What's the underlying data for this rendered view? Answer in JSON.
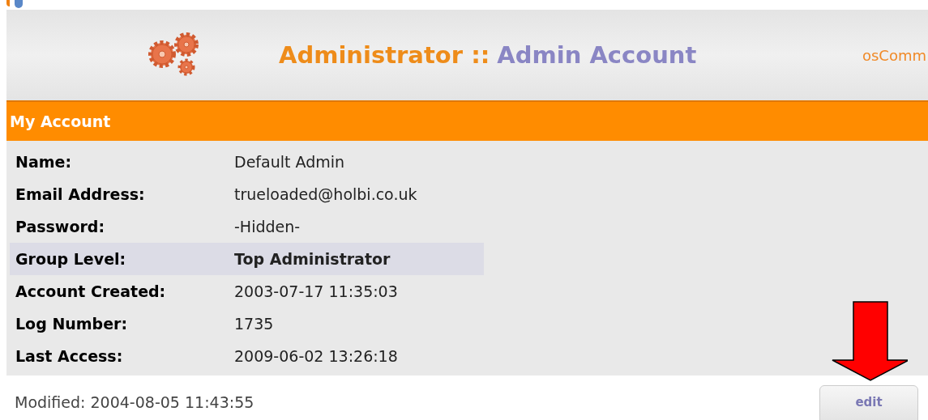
{
  "header": {
    "title_prefix": "Administrator ::",
    "title_page": "Admin Account",
    "brand": "osComm"
  },
  "section": {
    "title": "My Account"
  },
  "fields": [
    {
      "label": "Name:",
      "value": "Default Admin",
      "highlighted": false
    },
    {
      "label": "Email Address:",
      "value": "trueloaded@holbi.co.uk",
      "highlighted": false
    },
    {
      "label": "Password:",
      "value": "-Hidden-",
      "highlighted": false
    },
    {
      "label": "Group Level:",
      "value": "Top Administrator",
      "highlighted": true
    },
    {
      "label": "Account Created:",
      "value": "2003-07-17 11:35:03",
      "highlighted": false
    },
    {
      "label": "Log Number:",
      "value": "1735",
      "highlighted": false
    },
    {
      "label": "Last Access:",
      "value": "2009-06-02 13:26:18",
      "highlighted": false
    }
  ],
  "footer": {
    "modified": "Modified: 2004-08-05 11:43:55",
    "button": "edit"
  }
}
